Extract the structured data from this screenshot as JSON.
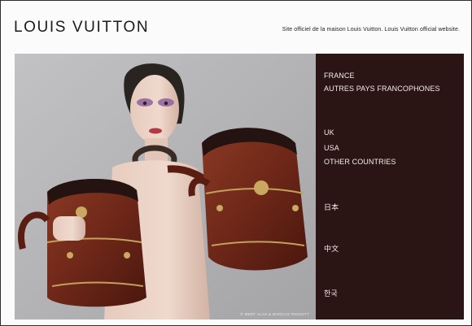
{
  "brand": {
    "logo_text": "LOUIS VUITTON",
    "tagline": "Site officiel de la maison Louis Vuitton. Louis Vuitton official website."
  },
  "hero": {
    "credit": "© MERT ALAS & MARCUS PIGGOTT"
  },
  "menu": {
    "items": [
      {
        "label": "FRANCE"
      },
      {
        "label": "AUTRES PAYS FRANCOPHONES"
      },
      {
        "label": "UK"
      },
      {
        "label": "USA"
      },
      {
        "label": "OTHER COUNTRIES"
      },
      {
        "label": "日本"
      },
      {
        "label": "中文"
      },
      {
        "label": "한국"
      }
    ]
  },
  "colors": {
    "menu_background": "#2b1414",
    "menu_text": "#f3ecea",
    "photo_background": "#b7b7b9"
  }
}
